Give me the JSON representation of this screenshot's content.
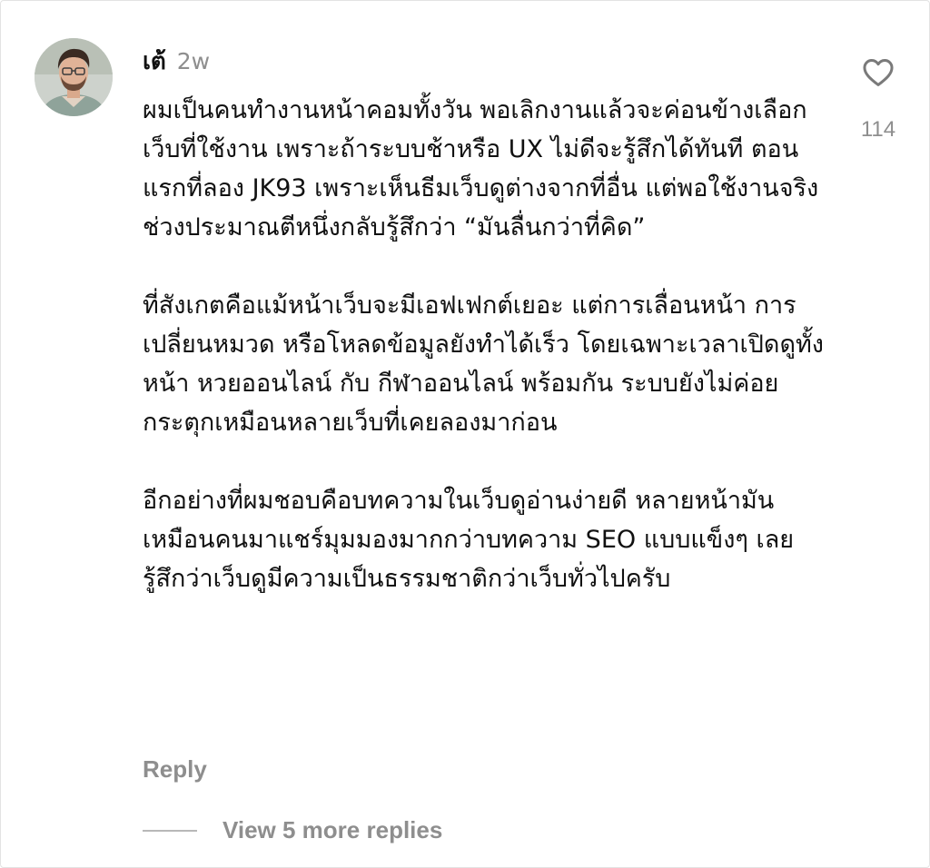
{
  "comment": {
    "author": "เต้",
    "timestamp": "2w",
    "avatar_icon": "user-avatar-photo",
    "paragraphs": [
      "ผมเป็นคนทำงานหน้าคอมทั้งวัน พอเลิกงานแล้วจะค่อนข้างเลือกเว็บที่ใช้งาน เพราะถ้าระบบช้าหรือ UX ไม่ดีจะรู้สึกได้ทันที ตอนแรกที่ลอง JK93 เพราะเห็นธีมเว็บดูต่างจากที่อื่น แต่พอใช้งานจริงช่วงประมาณตีหนึ่งกลับรู้สึกว่า “มันลื่นกว่าที่คิด”",
      "ที่สังเกตคือแม้หน้าเว็บจะมีเอฟเฟกต์เยอะ แต่การเลื่อนหน้า การเปลี่ยนหมวด หรือโหลดข้อมูลยังทำได้เร็ว โดยเฉพาะเวลาเปิดดูทั้งหน้า หวยออนไลน์ กับ กีฬาออนไลน์ พร้อมกัน ระบบยังไม่ค่อยกระตุกเหมือนหลายเว็บที่เคยลองมาก่อน",
      "อีกอย่างที่ผมชอบคือบทความในเว็บดูอ่านง่ายดี หลายหน้ามันเหมือนคนมาแชร์มุมมองมากกว่าบทความ SEO แบบแข็งๆ เลยรู้สึกว่าเว็บดูมีความเป็นธรรมชาติกว่าเว็บทั่วไปครับ"
    ],
    "like_icon": "heart-outline-icon",
    "like_count": "114",
    "reply_label": "Reply",
    "view_more_label": "View 5 more replies"
  }
}
